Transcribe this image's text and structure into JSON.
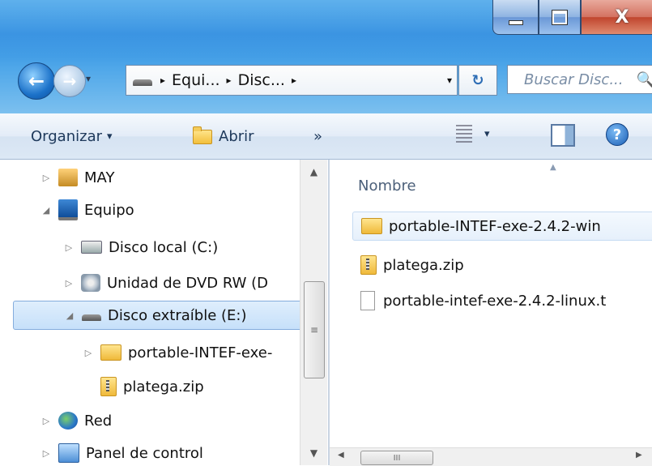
{
  "window": {
    "caption": {
      "minimize": "–",
      "maximize": "□",
      "close": "X"
    }
  },
  "nav": {
    "back_icon": "back-arrow-icon",
    "forward_icon": "forward-arrow-icon",
    "history_dropdown": "▾"
  },
  "address": {
    "crumbs": [
      "Equi...",
      "Disc..."
    ],
    "separator": "▸",
    "dropdown": "▾",
    "refresh": "↻"
  },
  "search": {
    "placeholder": "Buscar Disc...",
    "icon": "🔍"
  },
  "toolbar": {
    "organize_label": "Organizar",
    "organize_arrow": "▾",
    "open_label": "Abrir",
    "more_label": "»",
    "views_arrow": "▾",
    "help_label": "?"
  },
  "tree": {
    "items": [
      {
        "label": "MAY",
        "expander": "▷"
      },
      {
        "label": "Equipo",
        "expander": "◢"
      },
      {
        "label": "Disco local (C:)",
        "expander": "▷"
      },
      {
        "label": "Unidad de DVD RW (D",
        "expander": "▷"
      },
      {
        "label": "Disco extraíble (E:)",
        "expander": "◢"
      },
      {
        "label": "portable-INTEF-exe-",
        "expander": "▷"
      },
      {
        "label": "platega.zip",
        "expander": ""
      },
      {
        "label": "Red",
        "expander": "▷"
      },
      {
        "label": "Panel de control",
        "expander": "▷"
      }
    ],
    "scroll_up": "▲",
    "scroll_down": "▼",
    "thumb_grip": "≡"
  },
  "content": {
    "column_header": "Nombre",
    "sort_indicator": "▲",
    "files": [
      {
        "name": "portable-INTEF-exe-2.4.2-win"
      },
      {
        "name": "platega.zip"
      },
      {
        "name": "portable-intef-exe-2.4.2-linux.t"
      }
    ],
    "hscroll_left": "◀",
    "hscroll_right": "▶",
    "hscroll_grip": "III"
  }
}
